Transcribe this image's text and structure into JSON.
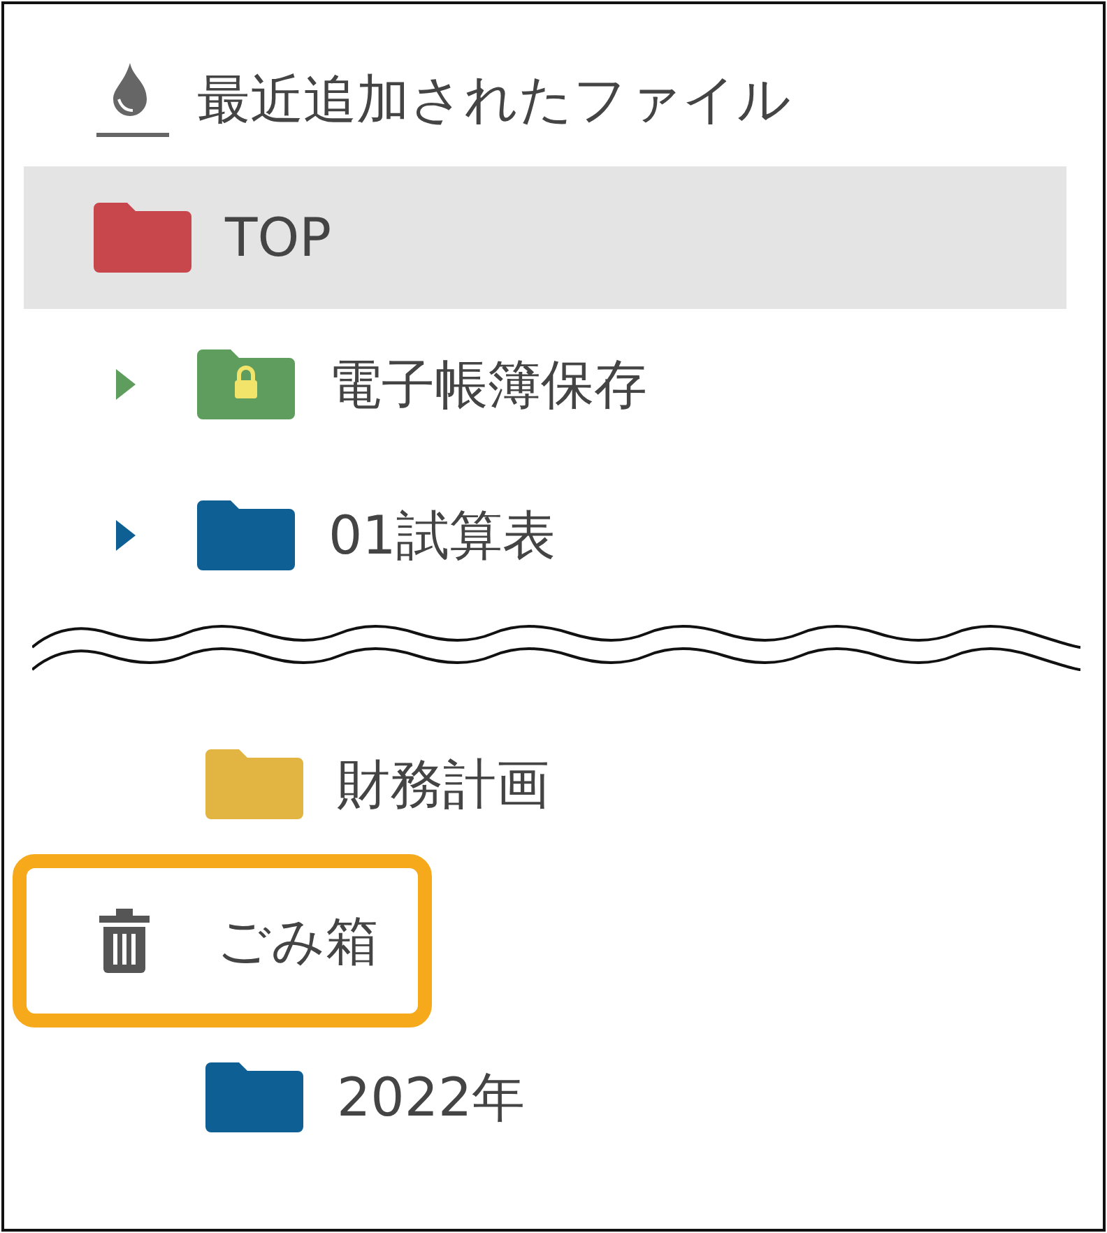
{
  "recent": {
    "label": "最近追加されたファイル"
  },
  "top_tree": [
    {
      "label": "TOP",
      "selected": true,
      "kind": "folder",
      "color": "#c8474d",
      "children": [
        {
          "label": "電子帳簿保存",
          "selected": false,
          "kind": "locked-folder",
          "color": "#5e9d5e",
          "expanded": false
        },
        {
          "label": "01試算表",
          "selected": false,
          "kind": "folder",
          "color": "#0e5f94",
          "expanded": false
        }
      ]
    }
  ],
  "lower_tree": [
    {
      "label": "財務計画",
      "selected": false,
      "kind": "folder",
      "color": "#e2b441"
    }
  ],
  "trash": {
    "label": "ごみ箱",
    "highlighted": true,
    "children": [
      {
        "label": "2022年",
        "selected": false,
        "kind": "folder",
        "color": "#0e5f94"
      }
    ]
  }
}
